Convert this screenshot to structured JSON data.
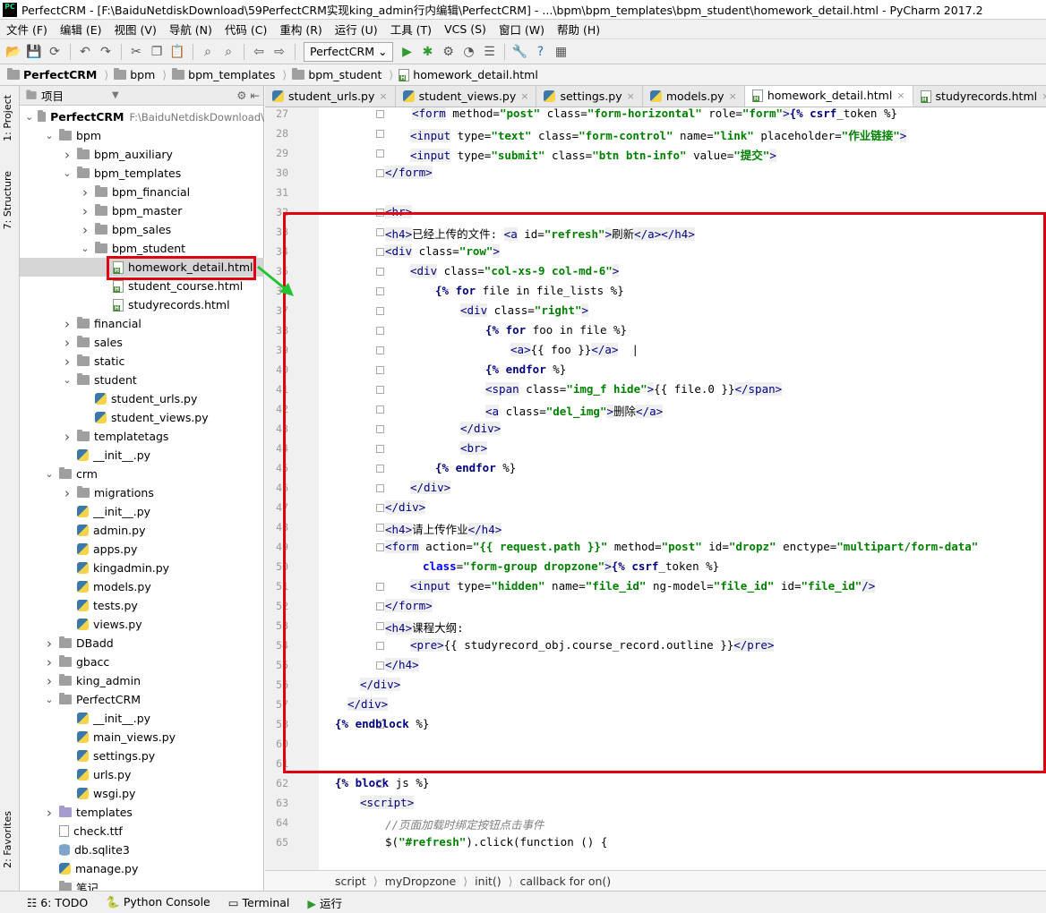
{
  "window": {
    "title": "PerfectCRM - [F:\\BaiduNetdiskDownload\\59PerfectCRM实现king_admin行内编辑\\PerfectCRM] - ...\\bpm\\bpm_templates\\bpm_student\\homework_detail.html - PyCharm 2017.2",
    "logo": "PC"
  },
  "menu": [
    "文件 (F)",
    "编辑 (E)",
    "视图 (V)",
    "导航 (N)",
    "代码 (C)",
    "重构 (R)",
    "运行 (U)",
    "工具 (T)",
    "VCS (S)",
    "窗口 (W)",
    "帮助 (H)"
  ],
  "toolbar": {
    "run_config": "PerfectCRM",
    "icons": [
      "open-icon",
      "save-icon",
      "sync-icon",
      "undo-icon",
      "redo-icon",
      "cut-icon",
      "copy-icon",
      "paste-icon",
      "find-icon",
      "replace-icon",
      "back-icon",
      "forward-icon",
      "run-icon",
      "debug-icon",
      "coverage-icon",
      "profile-icon",
      "tasks-icon",
      "settings-icon",
      "help-icon",
      "sdk-icon"
    ]
  },
  "breadcrumb": [
    "PerfectCRM",
    "bpm",
    "bpm_templates",
    "bpm_student",
    "homework_detail.html"
  ],
  "side_tabs": {
    "project": "1: Project",
    "structure": "7: Structure",
    "favorites": "2: Favorites"
  },
  "project_panel": {
    "title": "项目"
  },
  "tree": [
    {
      "label": "PerfectCRM",
      "extra": "F:\\BaiduNetdiskDownload\\",
      "level": 0,
      "type": "folder",
      "open": true,
      "bold": true
    },
    {
      "label": "bpm",
      "level": 1,
      "type": "folder",
      "open": true
    },
    {
      "label": "bpm_auxiliary",
      "level": 2,
      "type": "folder",
      "open": false
    },
    {
      "label": "bpm_templates",
      "level": 2,
      "type": "folder",
      "open": true
    },
    {
      "label": "bpm_financial",
      "level": 3,
      "type": "folder",
      "open": false
    },
    {
      "label": "bpm_master",
      "level": 3,
      "type": "folder",
      "open": false
    },
    {
      "label": "bpm_sales",
      "level": 3,
      "type": "folder",
      "open": false
    },
    {
      "label": "bpm_student",
      "level": 3,
      "type": "folder",
      "open": true
    },
    {
      "label": "homework_detail.html",
      "level": 4,
      "type": "html",
      "selected": true
    },
    {
      "label": "student_course.html",
      "level": 4,
      "type": "html"
    },
    {
      "label": "studyrecords.html",
      "level": 4,
      "type": "html"
    },
    {
      "label": "financial",
      "level": 2,
      "type": "folder",
      "open": false
    },
    {
      "label": "sales",
      "level": 2,
      "type": "folder",
      "open": false
    },
    {
      "label": "static",
      "level": 2,
      "type": "folder",
      "open": false
    },
    {
      "label": "student",
      "level": 2,
      "type": "folder",
      "open": true
    },
    {
      "label": "student_urls.py",
      "level": 3,
      "type": "py"
    },
    {
      "label": "student_views.py",
      "level": 3,
      "type": "py"
    },
    {
      "label": "templatetags",
      "level": 2,
      "type": "folder",
      "open": false
    },
    {
      "label": "__init__.py",
      "level": 2,
      "type": "py"
    },
    {
      "label": "crm",
      "level": 1,
      "type": "folder",
      "open": true
    },
    {
      "label": "migrations",
      "level": 2,
      "type": "folder",
      "open": false
    },
    {
      "label": "__init__.py",
      "level": 2,
      "type": "py"
    },
    {
      "label": "admin.py",
      "level": 2,
      "type": "py"
    },
    {
      "label": "apps.py",
      "level": 2,
      "type": "py"
    },
    {
      "label": "kingadmin.py",
      "level": 2,
      "type": "py"
    },
    {
      "label": "models.py",
      "level": 2,
      "type": "py"
    },
    {
      "label": "tests.py",
      "level": 2,
      "type": "py"
    },
    {
      "label": "views.py",
      "level": 2,
      "type": "py"
    },
    {
      "label": "DBadd",
      "level": 1,
      "type": "folder",
      "open": false
    },
    {
      "label": "gbacc",
      "level": 1,
      "type": "folder",
      "open": false
    },
    {
      "label": "king_admin",
      "level": 1,
      "type": "folder",
      "open": false
    },
    {
      "label": "PerfectCRM",
      "level": 1,
      "type": "folder",
      "open": true
    },
    {
      "label": "__init__.py",
      "level": 2,
      "type": "py"
    },
    {
      "label": "main_views.py",
      "level": 2,
      "type": "py"
    },
    {
      "label": "settings.py",
      "level": 2,
      "type": "py"
    },
    {
      "label": "urls.py",
      "level": 2,
      "type": "py"
    },
    {
      "label": "wsgi.py",
      "level": 2,
      "type": "py"
    },
    {
      "label": "templates",
      "level": 1,
      "type": "purple",
      "open": false
    },
    {
      "label": "check.ttf",
      "level": 1,
      "type": "ttf"
    },
    {
      "label": "db.sqlite3",
      "level": 1,
      "type": "db"
    },
    {
      "label": "manage.py",
      "level": 1,
      "type": "py"
    },
    {
      "label": "笔记",
      "level": 1,
      "type": "folder"
    }
  ],
  "tabs": [
    {
      "label": "student_urls.py",
      "type": "py"
    },
    {
      "label": "student_views.py",
      "type": "py"
    },
    {
      "label": "settings.py",
      "type": "py"
    },
    {
      "label": "models.py",
      "type": "py"
    },
    {
      "label": "homework_detail.html",
      "type": "html",
      "active": true
    },
    {
      "label": "studyrecords.html",
      "type": "html"
    }
  ],
  "code": [
    {
      "n": "27",
      "t": "    <form method=\"post\" class=\"form-horizontal\" role=\"form\">{% csrf_token %}",
      "i": 2
    },
    {
      "n": "28",
      "t": "<input type=\"text\" class=\"form-control\" name=\"link\" placeholder=\"作业链接\">",
      "i": 3
    },
    {
      "n": "29",
      "t": "<input type=\"submit\" class=\"btn btn-info\" value=\"提交\">",
      "i": 3
    },
    {
      "n": "30",
      "t": "</form>",
      "i": 2
    },
    {
      "n": "31",
      "t": "",
      "i": 0
    },
    {
      "n": "32",
      "t": "<hr>",
      "i": 2
    },
    {
      "n": "33",
      "t": "<h4>已经上传的文件: <a id=\"refresh\">刷新</a></h4>",
      "i": 2
    },
    {
      "n": "34",
      "t": "<div class=\"row\">",
      "i": 2
    },
    {
      "n": "35",
      "t": "<div class=\"col-xs-9 col-md-6\">",
      "i": 3
    },
    {
      "n": "36",
      "t": "{% for file in file_lists %}",
      "i": 4
    },
    {
      "n": "37",
      "t": "<div class=\"right\">",
      "i": 5
    },
    {
      "n": "38",
      "t": "{% for foo in file %}",
      "i": 6
    },
    {
      "n": "39",
      "t": "<a>{{ foo }}</a>  |",
      "i": 7
    },
    {
      "n": "40",
      "t": "{% endfor %}",
      "i": 6
    },
    {
      "n": "41",
      "t": "<span class=\"img_f hide\">{{ file.0 }}</span>",
      "i": 6
    },
    {
      "n": "42",
      "t": "<a class=\"del_img\">删除</a>",
      "i": 6
    },
    {
      "n": "43",
      "t": "</div>",
      "i": 5
    },
    {
      "n": "44",
      "t": "<br>",
      "i": 5
    },
    {
      "n": "45",
      "t": "{% endfor %}",
      "i": 4
    },
    {
      "n": "46",
      "t": "</div>",
      "i": 3
    },
    {
      "n": "47",
      "t": "</div>",
      "i": 2
    },
    {
      "n": "48",
      "t": "<h4>请上传作业</h4>",
      "i": 2
    },
    {
      "n": "49",
      "t": "<form action=\"{{ request.path }}\" method=\"post\" id=\"dropz\" enctype=\"multipart/form-data\"",
      "i": 2
    },
    {
      "n": "50",
      "t": "class=\"form-group dropzone\">{% csrf_token %}",
      "i": 3.5
    },
    {
      "n": "51",
      "t": "<input type=\"hidden\" name=\"file_id\" ng-model=\"file_id\" id=\"file_id\"/>",
      "i": 3
    },
    {
      "n": "52",
      "t": "</form>",
      "i": 2
    },
    {
      "n": "53",
      "t": "<h4>课程大纲:",
      "i": 2
    },
    {
      "n": "54",
      "t": "<pre>{{ studyrecord_obj.course_record.outline }}</pre>",
      "i": 3
    },
    {
      "n": "55",
      "t": "</h4>",
      "i": 2
    },
    {
      "n": "56",
      "t": "</div>",
      "i": 1
    },
    {
      "n": "57",
      "t": "</div>",
      "i": 0.5
    },
    {
      "n": "58",
      "t": "{% endblock %}",
      "i": 0
    },
    {
      "n": "60",
      "t": "",
      "i": 0
    },
    {
      "n": "61",
      "t": "",
      "i": 0
    },
    {
      "n": "62",
      "t": "{% block js %}",
      "i": 0
    },
    {
      "n": "63",
      "t": "<script>",
      "i": 1
    },
    {
      "n": "64",
      "t": "//页面加载时绑定按钮点击事件",
      "i": 2
    },
    {
      "n": "65",
      "t": "$(\"#refresh\").click(function () {",
      "i": 2
    }
  ],
  "structure_crumbs": [
    "script",
    "myDropzone",
    "init()",
    "callback for on()"
  ],
  "bottom": [
    "6: TODO",
    "Python Console",
    "Terminal",
    "运行"
  ],
  "colors": {
    "annotation": "#e0000f",
    "arrow": "#22c433"
  }
}
